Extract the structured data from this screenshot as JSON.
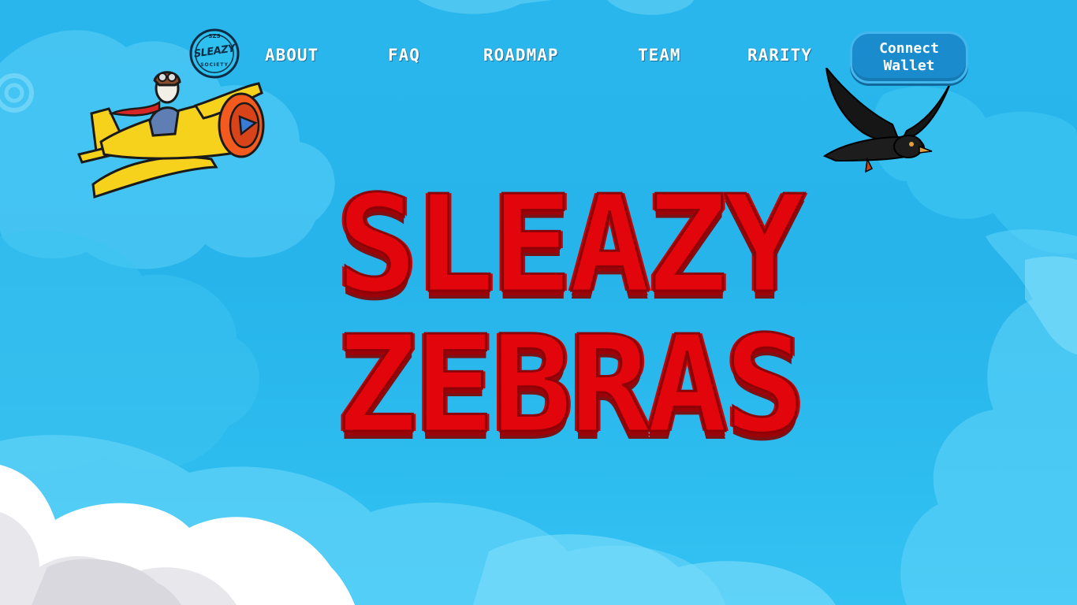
{
  "logo": {
    "top_text": "SZS",
    "main_text": "SLEAZY",
    "bottom_text": "SOCIETY"
  },
  "nav": {
    "items": [
      {
        "label": "About"
      },
      {
        "label": "FAQ"
      },
      {
        "label": "Roadmap"
      },
      {
        "label": "Team"
      },
      {
        "label": "Rarity"
      }
    ],
    "connect_label": "Connect\nWallet"
  },
  "hero": {
    "line1": "SLEAZY",
    "line2": "ZEBRAS"
  },
  "colors": {
    "sky": "#28b6ec",
    "title_red": "#e3050c",
    "button_blue": "#1a8ccd",
    "plane_yellow": "#f6d21c",
    "cloud_white": "#ffffff"
  },
  "icons": {
    "logo": "sleazy-society-badge",
    "plane": "biplane-pilot-illustration",
    "crow": "flying-crow-illustration"
  }
}
